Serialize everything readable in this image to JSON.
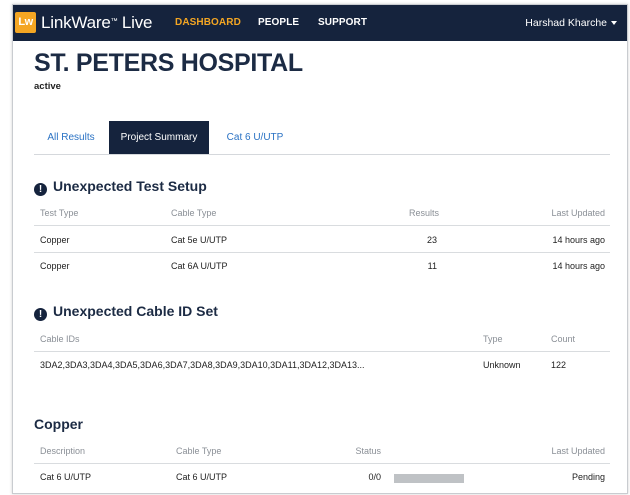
{
  "nav": {
    "logo": "Lw",
    "brand": "LinkWare",
    "brand_tm": "™",
    "brand_suffix": " Live",
    "items": [
      {
        "label": "DASHBOARD",
        "active": true
      },
      {
        "label": "PEOPLE",
        "active": false
      },
      {
        "label": "SUPPORT",
        "active": false
      }
    ],
    "user": "Harshad Kharche"
  },
  "page": {
    "title": "ST. PETERS HOSPITAL",
    "status": "active"
  },
  "tabs": [
    {
      "label": "All Results",
      "selected": false
    },
    {
      "label": "Project Summary",
      "selected": true
    },
    {
      "label": "Cat 6 U/UTP",
      "selected": false
    }
  ],
  "unexpected_test_setup": {
    "heading": "Unexpected Test Setup",
    "columns": [
      "Test Type",
      "Cable Type",
      "Results",
      "Last Updated"
    ],
    "rows": [
      {
        "test_type": "Copper",
        "cable_type": "Cat 5e U/UTP",
        "results": "23",
        "last_updated": "14 hours ago"
      },
      {
        "test_type": "Copper",
        "cable_type": "Cat 6A U/UTP",
        "results": "11",
        "last_updated": "14 hours ago"
      }
    ]
  },
  "unexpected_cable_id_set": {
    "heading": "Unexpected Cable ID Set",
    "columns": [
      "Cable IDs",
      "Type",
      "Count"
    ],
    "rows": [
      {
        "cable_ids": "3DA2,3DA3,3DA4,3DA5,3DA6,3DA7,3DA8,3DA9,3DA10,3DA11,3DA12,3DA13...",
        "type": "Unknown",
        "count": "122"
      }
    ]
  },
  "copper": {
    "heading": "Copper",
    "columns": [
      "Description",
      "Cable Type",
      "Status",
      "Last Updated"
    ],
    "rows": [
      {
        "description": "Cat 6 U/UTP",
        "cable_type": "Cat 6 U/UTP",
        "status": "0/0",
        "progress": 0,
        "last_updated": "Pending"
      }
    ]
  },
  "colors": {
    "nav_bg": "#15233d",
    "accent": "#f4a623",
    "link": "#2a72c4"
  }
}
